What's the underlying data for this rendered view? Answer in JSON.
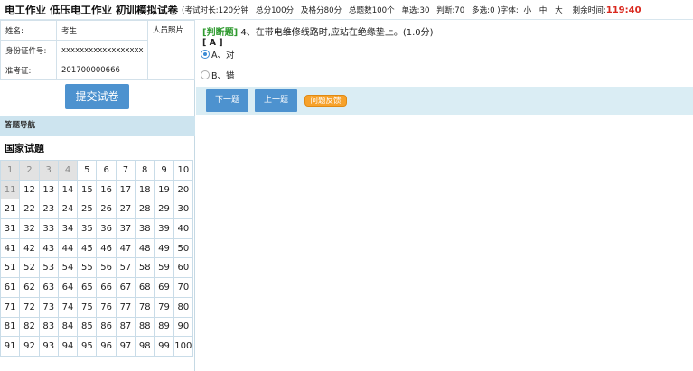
{
  "header": {
    "title": "电工作业 低压电工作业 初训模拟试卷",
    "duration": "(考试时长:120分钟",
    "total_score": "总分100分",
    "pass_score": "及格分80分",
    "question_count": "总题数100个",
    "single_choice": "单选:30",
    "judge": "判断:70",
    "multi_choice": "多选:0 )",
    "font_size_label": "字体:",
    "font_small": "小",
    "font_medium": "中",
    "font_large": "大",
    "remaining_label": "剩余时间:",
    "remaining_value": "119:40"
  },
  "candidate": {
    "name_label": "姓名:",
    "name_value": "考生",
    "id_label": "身份证件号:",
    "id_value": "xxxxxxxxxxxxxxxxxx",
    "ticket_label": "准考证:",
    "ticket_value": "201700000666",
    "photo_label": "人员照片"
  },
  "submit_label": "提交试卷",
  "nav": {
    "header": "答题导航",
    "section_title": "国家试题",
    "answered": [
      1,
      2,
      3,
      4,
      11
    ],
    "rows": [
      [
        "1",
        "2",
        "3",
        "4",
        "5",
        "6",
        "7",
        "8",
        "9",
        "10"
      ],
      [
        "11",
        "12",
        "13",
        "14",
        "15",
        "16",
        "17",
        "18",
        "19",
        "20"
      ],
      [
        "21",
        "22",
        "23",
        "24",
        "25",
        "26",
        "27",
        "28",
        "29",
        "30"
      ],
      [
        "31",
        "32",
        "33",
        "34",
        "35",
        "36",
        "37",
        "38",
        "39",
        "40"
      ],
      [
        "41",
        "42",
        "43",
        "44",
        "45",
        "46",
        "47",
        "48",
        "49",
        "50"
      ],
      [
        "51",
        "52",
        "53",
        "54",
        "55",
        "56",
        "57",
        "58",
        "59",
        "60"
      ],
      [
        "61",
        "62",
        "63",
        "64",
        "65",
        "66",
        "67",
        "68",
        "69",
        "70"
      ],
      [
        "71",
        "72",
        "73",
        "74",
        "75",
        "76",
        "77",
        "78",
        "79",
        "80"
      ],
      [
        "81",
        "82",
        "83",
        "84",
        "85",
        "86",
        "87",
        "88",
        "89",
        "90"
      ],
      [
        "91",
        "92",
        "93",
        "94",
        "95",
        "96",
        "97",
        "98",
        "99",
        "100"
      ]
    ]
  },
  "question": {
    "type": "[判断题]",
    "text": "4、在带电维修线路时,应站在绝缘垫上。(1.0分)",
    "answer": "[ A ]",
    "options": [
      {
        "label": "A、对",
        "selected": true
      },
      {
        "label": "B、错",
        "selected": false
      }
    ]
  },
  "buttons": {
    "next": "下一题",
    "prev": "上一题",
    "feedback": "问题反馈"
  },
  "colors": {
    "accent_blue": "#4d92cf",
    "nav_bg": "#cde4ef",
    "question_type": "#2f9a2f",
    "timer": "#d9281e",
    "feedback": "#f7a22b"
  }
}
